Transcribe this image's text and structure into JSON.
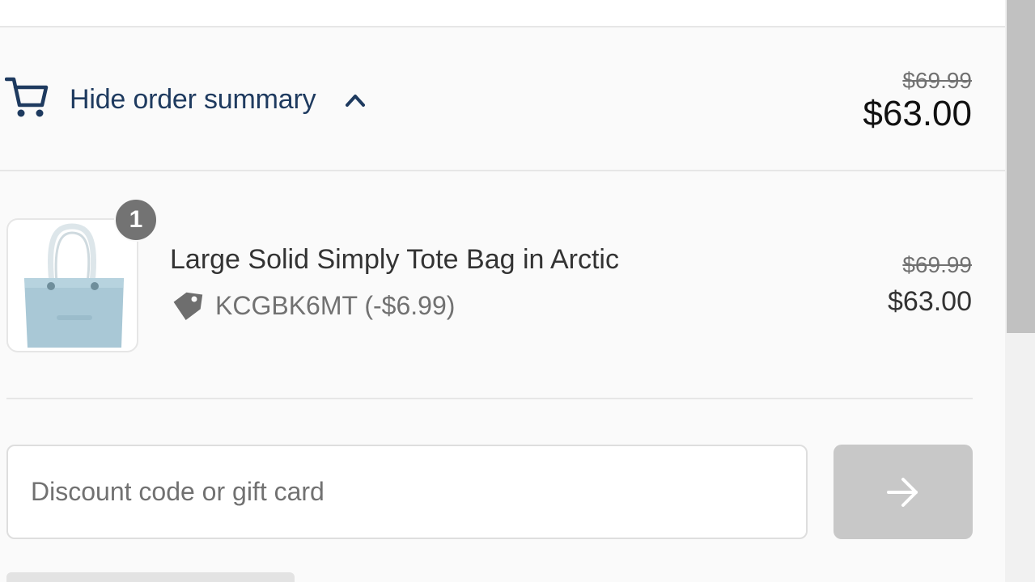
{
  "summary_toggle": {
    "label": "Hide order summary",
    "original_total": "$69.99",
    "total": "$63.00"
  },
  "product": {
    "quantity": "1",
    "name": "Large Solid Simply Tote Bag in Arctic",
    "discount": "KCGBK6MT (-$6.99)",
    "original_price": "$69.99",
    "price": "$63.00"
  },
  "discount_form": {
    "placeholder": "Discount code or gift card",
    "value": ""
  },
  "icons": {
    "cart": "cart-icon",
    "chevron": "chevron-up-icon",
    "tag": "tag-icon",
    "apply": "arrow-right-icon"
  },
  "colors": {
    "accent": "#1e3a5f",
    "muted_text": "#717171",
    "disabled_button": "#c8c8c8"
  }
}
